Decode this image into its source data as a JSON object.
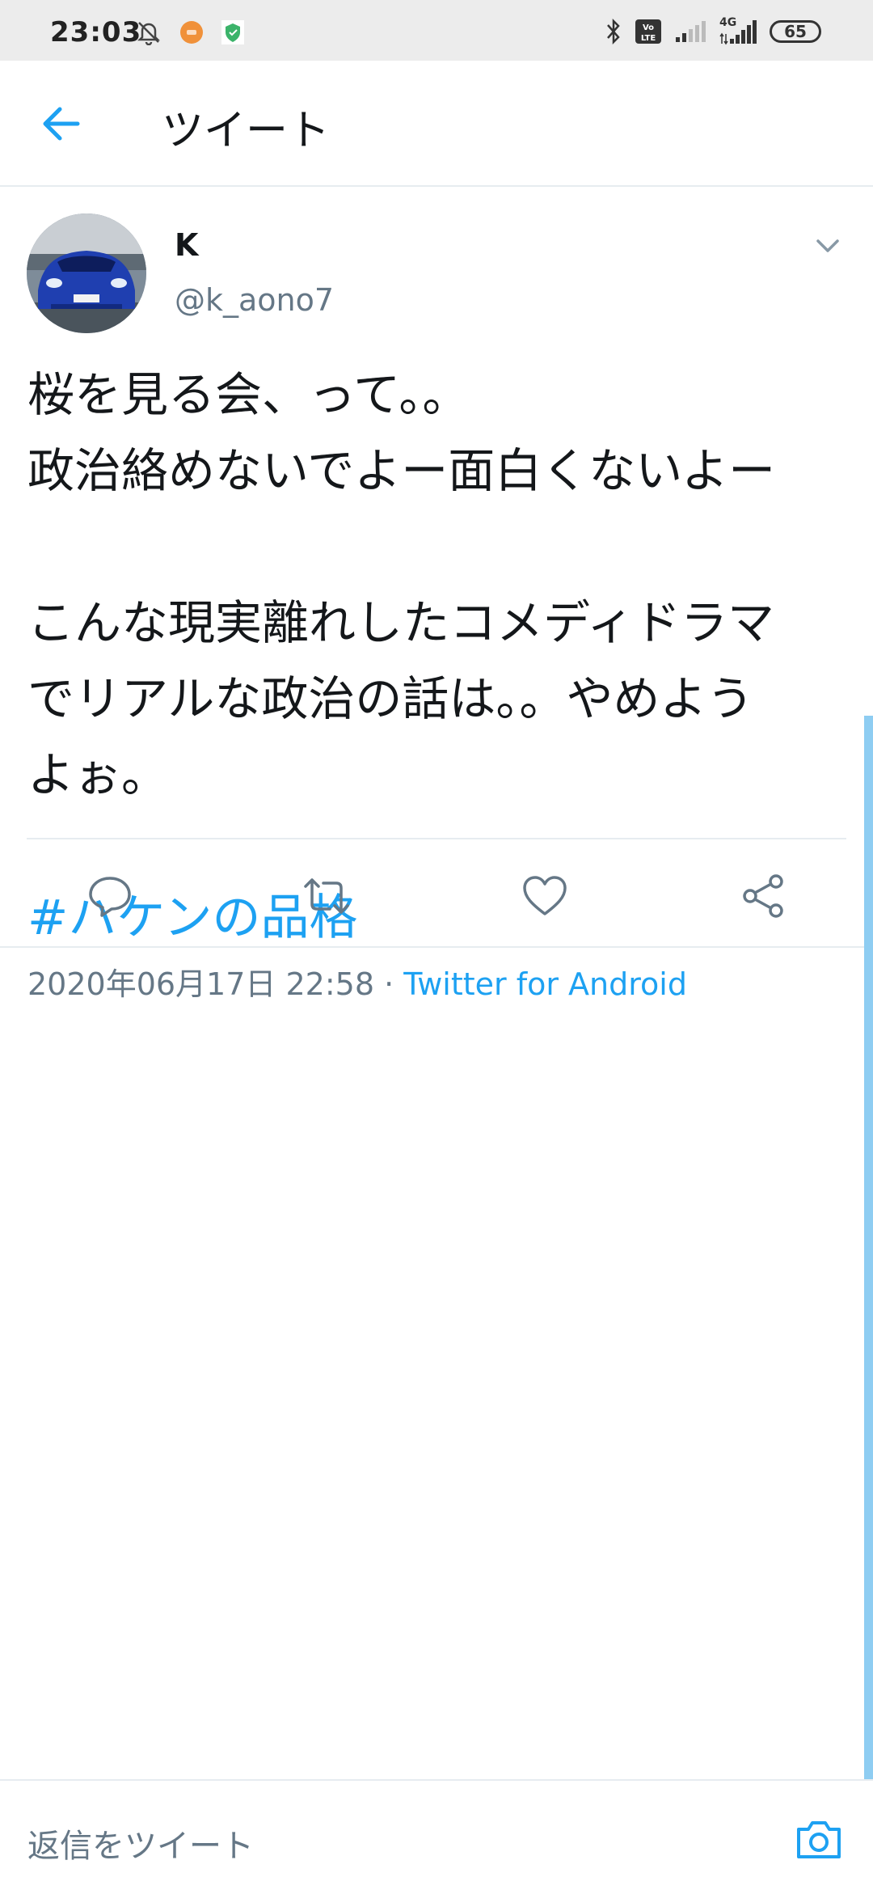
{
  "status_bar": {
    "time": "23:03",
    "network_type": "4G",
    "battery_level": "65",
    "icons": [
      "mute-bell-icon",
      "app-notification-icon",
      "shield-icon",
      "bluetooth-icon",
      "volte-icon",
      "signal-icon",
      "signal-4g-icon",
      "battery-icon"
    ]
  },
  "header": {
    "title": "ツイート",
    "back_icon": "arrow-left-icon"
  },
  "tweet": {
    "author_name": "K",
    "author_handle": "@k_aono7",
    "body_lines": [
      "桜を見る会、って。。",
      "政治絡めないでよー面白くないよー",
      "",
      "こんな現実離れしたコメディドラマ",
      "でリアルな政治の話は。。やめよう",
      "よぉ。"
    ],
    "hashtag": "#ハケンの品格",
    "timestamp": "2020年06月17日 22:58",
    "separator": " · ",
    "source": "Twitter for Android",
    "menu_icon": "chevron-down-icon"
  },
  "actions": [
    {
      "name": "reply",
      "icon": "reply-icon"
    },
    {
      "name": "retweet",
      "icon": "retweet-icon"
    },
    {
      "name": "like",
      "icon": "heart-icon"
    },
    {
      "name": "share",
      "icon": "share-icon"
    }
  ],
  "reply_bar": {
    "placeholder": "返信をツイート",
    "camera_icon": "camera-icon"
  },
  "colors": {
    "accent": "#1da1f2",
    "text": "#14171a",
    "secondary_text": "#657786",
    "divider": "#e6ecf0",
    "scrollbar": "#8ecdf2"
  }
}
